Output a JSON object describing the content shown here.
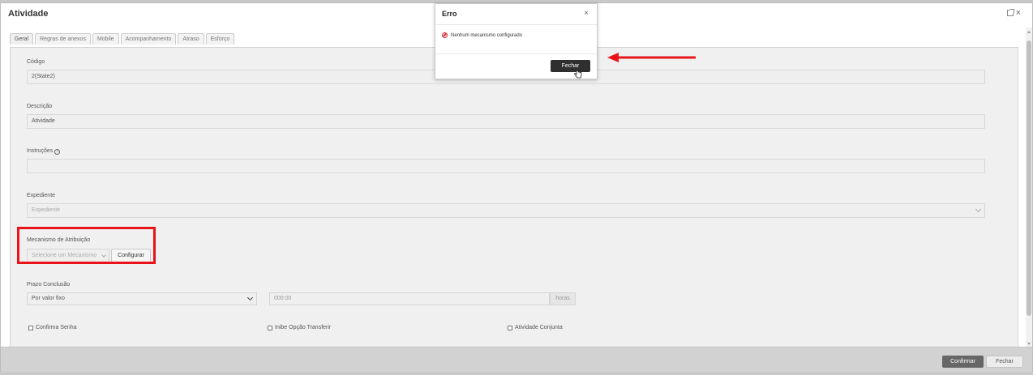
{
  "window": {
    "title": "Atividade"
  },
  "tabs": [
    "Geral",
    "Regras de anexos",
    "Mobile",
    "Acompanhamento",
    "Atraso",
    "Esforço"
  ],
  "form": {
    "codigo_label": "Código",
    "codigo_value": "2(State2)",
    "descricao_label": "Descrição",
    "descricao_value": "Atividade",
    "instrucoes_label": "Instruções",
    "instrucoes_info": "i",
    "instrucoes_value": "",
    "expediente_label": "Expediente",
    "expediente_value": "Expediente",
    "mecanismo_label": "Mecanismo de Atribuição",
    "mecanismo_value": "Selecione um Mecanismo",
    "configurar_label": "Configurar",
    "prazo_label": "Prazo Conclusão",
    "prazo_value": "Por valor fixo",
    "time_value": "000:00",
    "time_unit": "horas",
    "check_confirma": "Confirma Senha",
    "check_inibe": "Inibe Opção Transferir",
    "check_conjunta": "Atividade Conjunta"
  },
  "footer": {
    "confirm": "Confirmar",
    "close": "Fechar"
  },
  "dialog": {
    "title": "Erro",
    "close_glyph": "×",
    "message": "Nenhum mecanismo configurado",
    "button": "Fechar"
  },
  "colors": {
    "highlight": "#e8141a",
    "error": "#d9232e",
    "primary_dark": "#2f2f2f"
  }
}
